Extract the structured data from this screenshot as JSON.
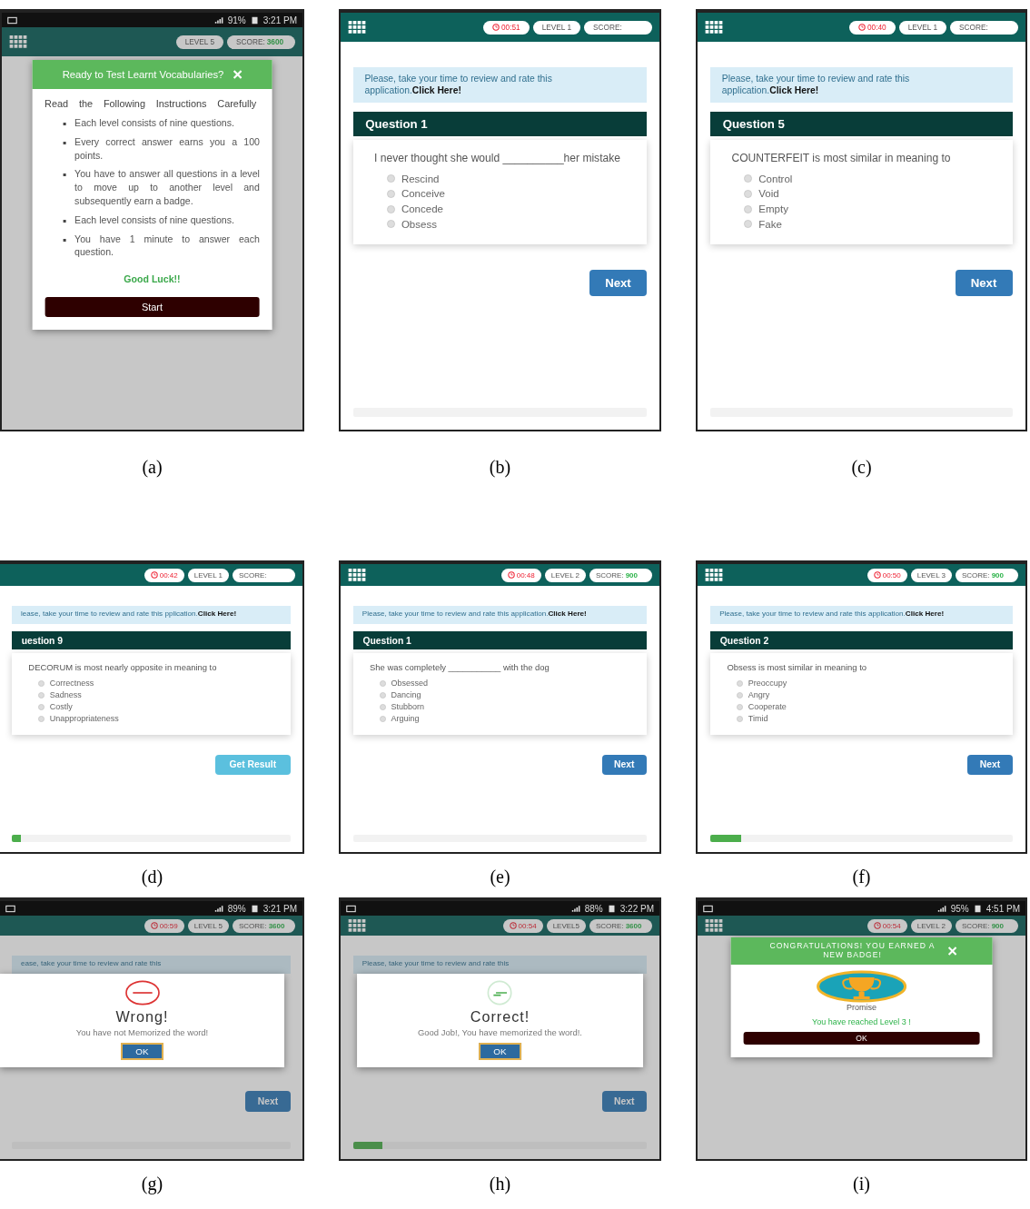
{
  "figure": {
    "panels": [
      {
        "caption": "(a)",
        "status_bar": {
          "battery": "91%",
          "time": "3:21 PM"
        },
        "top_bar": {
          "level": "LEVEL 5",
          "score_label": "SCORE:",
          "score_value": "3600"
        },
        "dialog": {
          "kind": "instructions",
          "title": "Ready to Test Learnt Vocabularies?",
          "intro": "Read the Following Instructions Carefully",
          "bullets": [
            "Each level consists of nine questions.",
            "Every correct answer earns you a 100 points.",
            "You have to answer all questions in a level to move up to another level and subsequently earn a badge.",
            "Each level consists of nine questions.",
            "You have 1 minute to answer each question."
          ],
          "footer": "Good Luck!!",
          "button": "Start"
        }
      },
      {
        "caption": "(b)",
        "top_bar": {
          "timer": "00:51",
          "level": "LEVEL 1",
          "score_label": "SCORE:"
        },
        "banner": {
          "text": "Please, take your time to review and rate this application.",
          "link": "Click Here!"
        },
        "question": {
          "title": "Question 1",
          "text": "I never thought she would __________her mistake",
          "options": [
            {
              "label": "Rescind",
              "selected": false
            },
            {
              "label": "Conceive",
              "selected": false
            },
            {
              "label": "Concede",
              "selected": false
            },
            {
              "label": "Obsess",
              "selected": false
            }
          ]
        },
        "button": {
          "label": "Next",
          "kind": "next"
        },
        "progress": {
          "level": 0
        }
      },
      {
        "caption": "(c)",
        "top_bar": {
          "timer": "00:40",
          "level": "LEVEL 1",
          "score_label": "SCORE:"
        },
        "banner": {
          "text": "Please, take your time to review and rate this application.",
          "link": "Click Here!"
        },
        "question": {
          "title": "Question 5",
          "text": "COUNTERFEIT is most similar in meaning to",
          "options": [
            {
              "label": "Control",
              "selected": false
            },
            {
              "label": "Void",
              "selected": false
            },
            {
              "label": "Empty",
              "selected": false
            },
            {
              "label": "Fake",
              "selected": false
            }
          ]
        },
        "button": {
          "label": "Next",
          "kind": "next"
        },
        "progress": {
          "level": 0
        }
      },
      {
        "caption": "(d)",
        "cropped_left": true,
        "top_bar": {
          "timer": "00:42",
          "level": "LEVEL 1",
          "score_label": "SCORE:"
        },
        "banner": {
          "text": "lease, take your time to review and rate this pplication.",
          "link": "Click Here!"
        },
        "question": {
          "title": "uestion 9",
          "text": "DECORUM is most nearly opposite in meaning to",
          "options": [
            {
              "label": "Correctness",
              "selected": false
            },
            {
              "label": "Sadness",
              "selected": false
            },
            {
              "label": "Costly",
              "selected": false
            },
            {
              "label": "Unappropriateness",
              "selected": false
            }
          ]
        },
        "button": {
          "label": "Get Result",
          "kind": "result"
        },
        "progress": {
          "level": 0.03
        }
      },
      {
        "caption": "(e)",
        "top_bar": {
          "timer": "00:48",
          "level": "LEVEL 2",
          "score_label": "SCORE:",
          "score_value": "900"
        },
        "banner": {
          "text": "Please, take your time to review and rate this application.",
          "link": "Click Here!"
        },
        "question": {
          "title": "Question 1",
          "text": "She was completely ___________ with the dog",
          "options": [
            {
              "label": "Obsessed",
              "selected": false
            },
            {
              "label": "Dancing",
              "selected": false
            },
            {
              "label": "Stubborn",
              "selected": false
            },
            {
              "label": "Arguing",
              "selected": false
            }
          ]
        },
        "button": {
          "label": "Next",
          "kind": "next"
        },
        "progress": {
          "level": 0
        }
      },
      {
        "caption": "(f)",
        "top_bar": {
          "timer": "00:50",
          "level": "LEVEL 3",
          "score_label": "SCORE:",
          "score_value": "900"
        },
        "banner": {
          "text": "Please, take your time to review and rate this application.",
          "link": "Click Here!"
        },
        "question": {
          "title": "Question 2",
          "text": "Obsess is most similar in meaning to",
          "options": [
            {
              "label": "Preoccupy",
              "selected": false
            },
            {
              "label": "Angry",
              "selected": false
            },
            {
              "label": "Cooperate",
              "selected": false
            },
            {
              "label": "Timid",
              "selected": false
            }
          ]
        },
        "button": {
          "label": "Next",
          "kind": "next"
        },
        "progress": {
          "level": 0.1
        }
      },
      {
        "caption": "(g)",
        "cropped_left": true,
        "status_bar": {
          "battery": "89%",
          "time": "3:21 PM"
        },
        "top_bar": {
          "timer": "00:59",
          "level": "LEVEL 5",
          "score_label": "SCORE:",
          "score_value": "3600"
        },
        "banner": {
          "text": "ease, take your time to review and rate this"
        },
        "button": {
          "label": "Next",
          "kind": "next"
        },
        "progress": {
          "level": 0
        },
        "dialog": {
          "kind": "wrong",
          "title": "Wrong!",
          "message": "You have not Memorized the word!",
          "button": "OK"
        }
      },
      {
        "caption": "(h)",
        "status_bar": {
          "battery": "88%",
          "time": "3:22 PM"
        },
        "top_bar": {
          "timer": "00:54",
          "level": "LEVEL5",
          "score_label": "SCORE:",
          "score_value": "3600"
        },
        "banner": {
          "text": "Please, take your time to review and rate this"
        },
        "button": {
          "label": "Next",
          "kind": "next"
        },
        "progress": {
          "level": 0.1
        },
        "dialog": {
          "kind": "correct",
          "title": "Correct!",
          "message": "Good Job!, You have memorized the word!.",
          "button": "OK"
        }
      },
      {
        "caption": "(i)",
        "status_bar": {
          "battery": "95%",
          "time": "4:51 PM"
        },
        "top_bar": {
          "timer": "00:54",
          "level": "LEVEL 2",
          "score_label": "SCORE:",
          "score_value": "900"
        },
        "dialog": {
          "kind": "badge",
          "title": "CONGRATULATIONS! YOU EARNED A NEW BADGE!",
          "badge_name": "Promise",
          "message": "You have reached Level 3 !",
          "button": "OK"
        }
      }
    ]
  }
}
